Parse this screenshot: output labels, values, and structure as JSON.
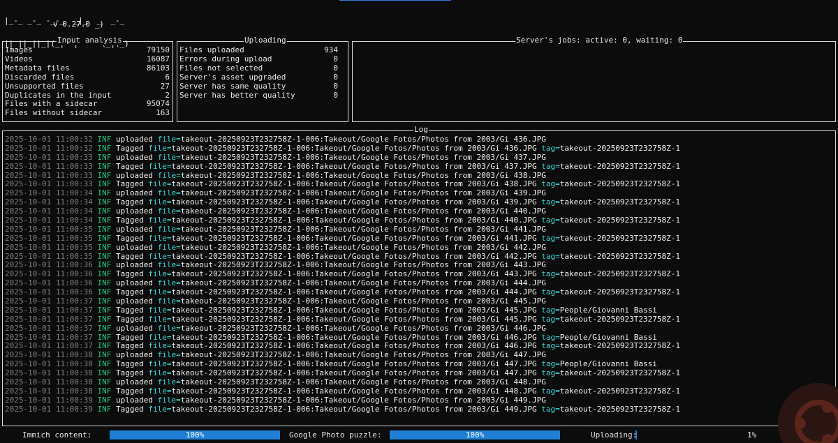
{
  "header": {
    "logo_lines": [
      "|_-_ _-_ -_-_  _|_  _  _-_",
      "|| ||_||_|(_|  |  -  (_|(_)"
    ],
    "version": "v 0.27.0 _)"
  },
  "input_analysis": {
    "title": "Input analysis",
    "rows": [
      {
        "label": "Images",
        "value": "79150"
      },
      {
        "label": "Videos",
        "value": "16087"
      },
      {
        "label": "Metadata files",
        "value": "86103"
      },
      {
        "label": "Discarded files",
        "value": "6"
      },
      {
        "label": "Unsupported files",
        "value": "27"
      },
      {
        "label": "Duplicates in the input",
        "value": "2"
      },
      {
        "label": "Files with a sidecar",
        "value": "95074"
      },
      {
        "label": "Files without sidecar",
        "value": "163"
      }
    ]
  },
  "uploading": {
    "title": "Uploading",
    "rows": [
      {
        "label": "Files uploaded",
        "value": "934"
      },
      {
        "label": "Errors during upload",
        "value": "0"
      },
      {
        "label": "Files not selected",
        "value": "0"
      },
      {
        "label": "Server's asset upgraded",
        "value": "0"
      },
      {
        "label": "Server has same quality",
        "value": "0"
      },
      {
        "label": "Server has better quality",
        "value": "0"
      }
    ]
  },
  "jobs": {
    "title": "Server's jobs: active: 0, waiting: 0"
  },
  "log": {
    "title": "Log",
    "file_key": "file=",
    "tag_key": "tag=",
    "lines": [
      {
        "ts": "2025-10-01 11:00:32",
        "lvl": "INF",
        "msg": "uploaded",
        "file": "takeout-20250923T232758Z-1-006:Takeout/Google Fotos/Photos from 2003/Gi 436.JPG",
        "tag": ""
      },
      {
        "ts": "2025-10-01 11:00:32",
        "lvl": "INF",
        "msg": "Tagged",
        "file": "takeout-20250923T232758Z-1-006:Takeout/Google Fotos/Photos from 2003/Gi 436.JPG",
        "tag": "takeout-20250923T232758Z-1"
      },
      {
        "ts": "2025-10-01 11:00:33",
        "lvl": "INF",
        "msg": "uploaded",
        "file": "takeout-20250923T232758Z-1-006:Takeout/Google Fotos/Photos from 2003/Gi 437.JPG",
        "tag": ""
      },
      {
        "ts": "2025-10-01 11:00:33",
        "lvl": "INF",
        "msg": "Tagged",
        "file": "takeout-20250923T232758Z-1-006:Takeout/Google Fotos/Photos from 2003/Gi 437.JPG",
        "tag": "takeout-20250923T232758Z-1"
      },
      {
        "ts": "2025-10-01 11:00:33",
        "lvl": "INF",
        "msg": "uploaded",
        "file": "takeout-20250923T232758Z-1-006:Takeout/Google Fotos/Photos from 2003/Gi 438.JPG",
        "tag": ""
      },
      {
        "ts": "2025-10-01 11:00:33",
        "lvl": "INF",
        "msg": "Tagged",
        "file": "takeout-20250923T232758Z-1-006:Takeout/Google Fotos/Photos from 2003/Gi 438.JPG",
        "tag": "takeout-20250923T232758Z-1"
      },
      {
        "ts": "2025-10-01 11:00:34",
        "lvl": "INF",
        "msg": "uploaded",
        "file": "takeout-20250923T232758Z-1-006:Takeout/Google Fotos/Photos from 2003/Gi 439.JPG",
        "tag": ""
      },
      {
        "ts": "2025-10-01 11:00:34",
        "lvl": "INF",
        "msg": "Tagged",
        "file": "takeout-20250923T232758Z-1-006:Takeout/Google Fotos/Photos from 2003/Gi 439.JPG",
        "tag": "takeout-20250923T232758Z-1"
      },
      {
        "ts": "2025-10-01 11:00:34",
        "lvl": "INF",
        "msg": "uploaded",
        "file": "takeout-20250923T232758Z-1-006:Takeout/Google Fotos/Photos from 2003/Gi 440.JPG",
        "tag": ""
      },
      {
        "ts": "2025-10-01 11:00:34",
        "lvl": "INF",
        "msg": "Tagged",
        "file": "takeout-20250923T232758Z-1-006:Takeout/Google Fotos/Photos from 2003/Gi 440.JPG",
        "tag": "takeout-20250923T232758Z-1"
      },
      {
        "ts": "2025-10-01 11:00:35",
        "lvl": "INF",
        "msg": "uploaded",
        "file": "takeout-20250923T232758Z-1-006:Takeout/Google Fotos/Photos from 2003/Gi 441.JPG",
        "tag": ""
      },
      {
        "ts": "2025-10-01 11:00:35",
        "lvl": "INF",
        "msg": "Tagged",
        "file": "takeout-20250923T232758Z-1-006:Takeout/Google Fotos/Photos from 2003/Gi 441.JPG",
        "tag": "takeout-20250923T232758Z-1"
      },
      {
        "ts": "2025-10-01 11:00:35",
        "lvl": "INF",
        "msg": "uploaded",
        "file": "takeout-20250923T232758Z-1-006:Takeout/Google Fotos/Photos from 2003/Gi 442.JPG",
        "tag": ""
      },
      {
        "ts": "2025-10-01 11:00:35",
        "lvl": "INF",
        "msg": "Tagged",
        "file": "takeout-20250923T232758Z-1-006:Takeout/Google Fotos/Photos from 2003/Gi 442.JPG",
        "tag": "takeout-20250923T232758Z-1"
      },
      {
        "ts": "2025-10-01 11:00:36",
        "lvl": "INF",
        "msg": "uploaded",
        "file": "takeout-20250923T232758Z-1-006:Takeout/Google Fotos/Photos from 2003/Gi 443.JPG",
        "tag": ""
      },
      {
        "ts": "2025-10-01 11:00:36",
        "lvl": "INF",
        "msg": "Tagged",
        "file": "takeout-20250923T232758Z-1-006:Takeout/Google Fotos/Photos from 2003/Gi 443.JPG",
        "tag": "takeout-20250923T232758Z-1"
      },
      {
        "ts": "2025-10-01 11:00:36",
        "lvl": "INF",
        "msg": "uploaded",
        "file": "takeout-20250923T232758Z-1-006:Takeout/Google Fotos/Photos from 2003/Gi 444.JPG",
        "tag": ""
      },
      {
        "ts": "2025-10-01 11:00:36",
        "lvl": "INF",
        "msg": "Tagged",
        "file": "takeout-20250923T232758Z-1-006:Takeout/Google Fotos/Photos from 2003/Gi 444.JPG",
        "tag": "takeout-20250923T232758Z-1"
      },
      {
        "ts": "2025-10-01 11:00:37",
        "lvl": "INF",
        "msg": "uploaded",
        "file": "takeout-20250923T232758Z-1-006:Takeout/Google Fotos/Photos from 2003/Gi 445.JPG",
        "tag": ""
      },
      {
        "ts": "2025-10-01 11:00:37",
        "lvl": "INF",
        "msg": "Tagged",
        "file": "takeout-20250923T232758Z-1-006:Takeout/Google Fotos/Photos from 2003/Gi 445.JPG",
        "tag": "People/Giovanni Bassi"
      },
      {
        "ts": "2025-10-01 11:00:37",
        "lvl": "INF",
        "msg": "Tagged",
        "file": "takeout-20250923T232758Z-1-006:Takeout/Google Fotos/Photos from 2003/Gi 445.JPG",
        "tag": "takeout-20250923T232758Z-1"
      },
      {
        "ts": "2025-10-01 11:00:37",
        "lvl": "INF",
        "msg": "uploaded",
        "file": "takeout-20250923T232758Z-1-006:Takeout/Google Fotos/Photos from 2003/Gi 446.JPG",
        "tag": ""
      },
      {
        "ts": "2025-10-01 11:00:37",
        "lvl": "INF",
        "msg": "Tagged",
        "file": "takeout-20250923T232758Z-1-006:Takeout/Google Fotos/Photos from 2003/Gi 446.JPG",
        "tag": "People/Giovanni Bassi"
      },
      {
        "ts": "2025-10-01 11:00:37",
        "lvl": "INF",
        "msg": "Tagged",
        "file": "takeout-20250923T232758Z-1-006:Takeout/Google Fotos/Photos from 2003/Gi 446.JPG",
        "tag": "takeout-20250923T232758Z-1"
      },
      {
        "ts": "2025-10-01 11:00:38",
        "lvl": "INF",
        "msg": "uploaded",
        "file": "takeout-20250923T232758Z-1-006:Takeout/Google Fotos/Photos from 2003/Gi 447.JPG",
        "tag": ""
      },
      {
        "ts": "2025-10-01 11:00:38",
        "lvl": "INF",
        "msg": "Tagged",
        "file": "takeout-20250923T232758Z-1-006:Takeout/Google Fotos/Photos from 2003/Gi 447.JPG",
        "tag": "People/Giovanni Bassi"
      },
      {
        "ts": "2025-10-01 11:00:38",
        "lvl": "INF",
        "msg": "Tagged",
        "file": "takeout-20250923T232758Z-1-006:Takeout/Google Fotos/Photos from 2003/Gi 447.JPG",
        "tag": "takeout-20250923T232758Z-1"
      },
      {
        "ts": "2025-10-01 11:00:38",
        "lvl": "INF",
        "msg": "uploaded",
        "file": "takeout-20250923T232758Z-1-006:Takeout/Google Fotos/Photos from 2003/Gi 448.JPG",
        "tag": ""
      },
      {
        "ts": "2025-10-01 11:00:38",
        "lvl": "INF",
        "msg": "Tagged",
        "file": "takeout-20250923T232758Z-1-006:Takeout/Google Fotos/Photos from 2003/Gi 448.JPG",
        "tag": "takeout-20250923T232758Z-1"
      },
      {
        "ts": "2025-10-01 11:00:39",
        "lvl": "INF",
        "msg": "uploaded",
        "file": "takeout-20250923T232758Z-1-006:Takeout/Google Fotos/Photos from 2003/Gi 449.JPG",
        "tag": ""
      },
      {
        "ts": "2025-10-01 11:00:39",
        "lvl": "INF",
        "msg": "Tagged",
        "file": "takeout-20250923T232758Z-1-006:Takeout/Google Fotos/Photos from 2003/Gi 449.JPG",
        "tag": "takeout-20250923T232758Z-1"
      }
    ]
  },
  "progress": {
    "immich": {
      "label": "Immich content:",
      "text": "100%",
      "fraction": 1.0
    },
    "puzzle": {
      "label": "Google Photo puzzle:",
      "text": "100%",
      "fraction": 1.0
    },
    "uploading": {
      "label": "Uploading:",
      "text": "1%",
      "fraction": 0.01
    }
  },
  "colors": {
    "bar": "#1f7fd6",
    "timestamp": "#7f7f7f",
    "level": "#21c47b",
    "key": "#3fd6d6",
    "background": "#0c0c0c"
  },
  "icons": {
    "corner_logo": "ubuntu-logo-icon"
  }
}
